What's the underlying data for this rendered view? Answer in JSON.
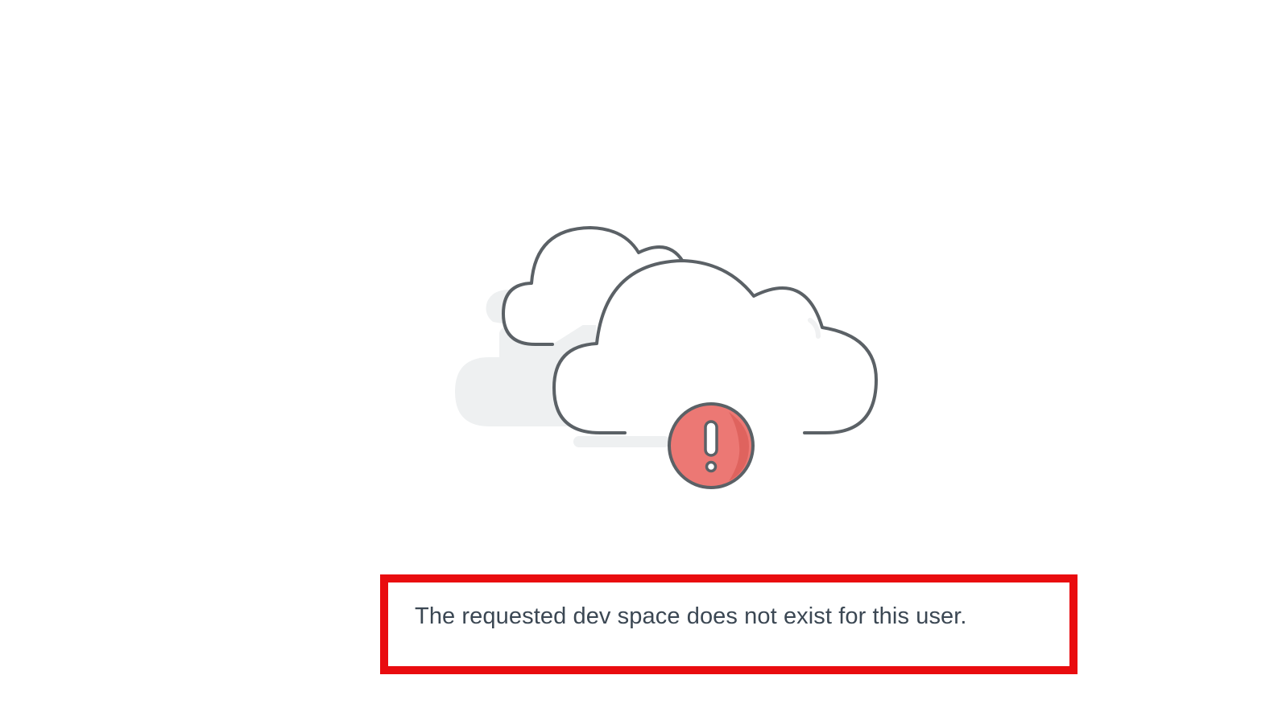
{
  "illustration": {
    "icon": "cloud-error-icon",
    "colors": {
      "outline": "#5b6166",
      "shadow": "#eef0f1",
      "error_fill": "#ec7874",
      "error_shade": "#dd5f5a"
    }
  },
  "message": {
    "text": "The requested dev space does not exist for this user.",
    "highlight_color": "#e90c0f",
    "text_color": "#3b4753"
  }
}
